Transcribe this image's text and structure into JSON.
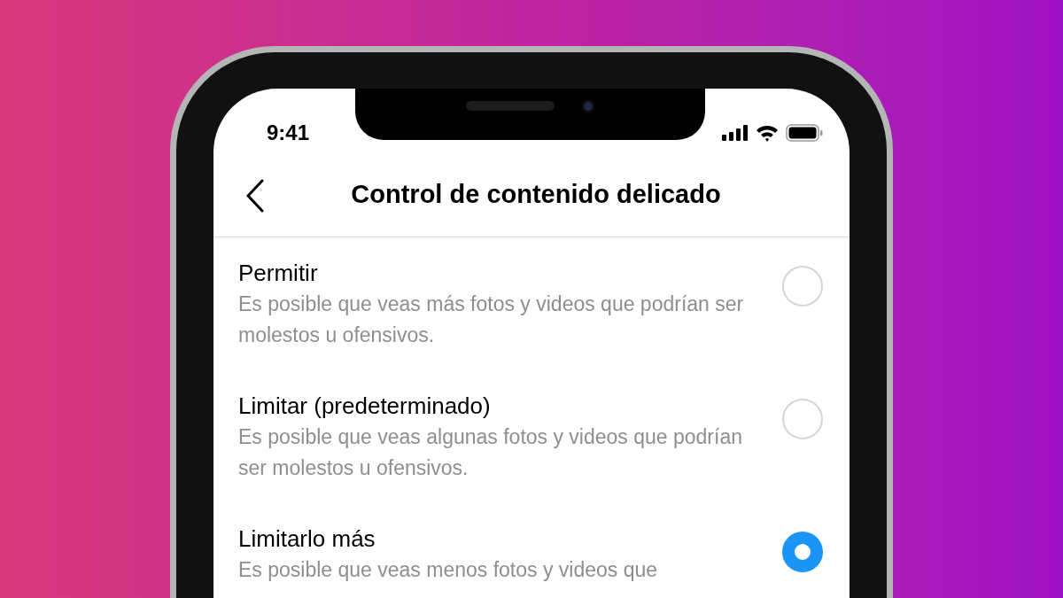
{
  "status_bar": {
    "time": "9:41"
  },
  "header": {
    "title": "Control de contenido delicado"
  },
  "options": [
    {
      "label": "Permitir",
      "description": "Es posible que veas más fotos y videos que podrían ser molestos u ofensivos.",
      "selected": false
    },
    {
      "label": "Limitar (predeterminado)",
      "description": "Es posible que veas algunas fotos y videos que podrían ser molestos u ofensivos.",
      "selected": false
    },
    {
      "label": "Limitarlo más",
      "description": "Es posible que veas menos fotos y videos que",
      "selected": true
    }
  ]
}
